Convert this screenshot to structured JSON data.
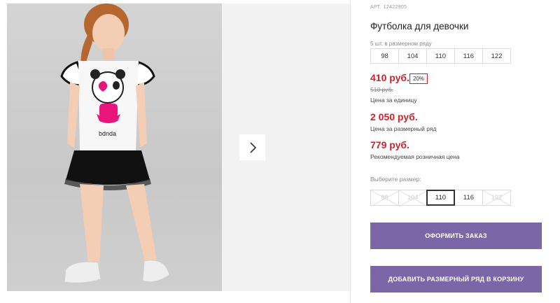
{
  "product": {
    "article_label": "АРТ.",
    "article_number": "12422905",
    "title": "Футболка для девочки",
    "pack_note": "5 шт. в размерном ряду",
    "pack_sizes": [
      "98",
      "104",
      "110",
      "116",
      "122"
    ]
  },
  "pricing": {
    "unit_price": "410 руб.",
    "discount_badge": "20%",
    "old_price": "510 руб.",
    "unit_caption": "Цена за единицу",
    "pack_price": "2 050 руб.",
    "pack_caption": "Цена за размерный ряд",
    "retail_price": "779 руб.",
    "retail_caption": "Рекомендуемая розничная цена"
  },
  "size_select": {
    "label": "Выберите размер:",
    "options": [
      {
        "label": "98",
        "state": "unavailable"
      },
      {
        "label": "104",
        "state": "unavailable"
      },
      {
        "label": "110",
        "state": "selected"
      },
      {
        "label": "116",
        "state": "available"
      },
      {
        "label": "122",
        "state": "unavailable"
      }
    ]
  },
  "actions": {
    "order_button": "ОФОРМИТЬ ЗАКАЗ",
    "add_button": "ДОБАВИТЬ РАЗМЕРНЫЙ РЯД В КОРЗИНУ"
  },
  "gallery": {
    "next_icon": "chevron-right-icon",
    "shirt_print": "panda"
  },
  "colors": {
    "price": "#d4202b",
    "button": "#7b67a8",
    "gallery_bg": "#f2f2f2"
  }
}
